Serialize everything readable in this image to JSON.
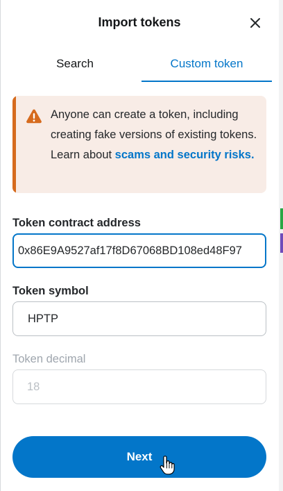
{
  "header": {
    "title": "Import tokens"
  },
  "tabs": [
    {
      "label": "Search",
      "active": false
    },
    {
      "label": "Custom token",
      "active": true
    }
  ],
  "warning": {
    "message": "Anyone can create a token, including creating fake versions of existing tokens. Learn about",
    "link_text": "scams and security risks."
  },
  "form": {
    "contract_label": "Token contract address",
    "contract_value": "0x86E9A9527af17f8D67068BD108ed48F97",
    "symbol_label": "Token symbol",
    "symbol_value": "HPTP",
    "decimal_label": "Token decimal",
    "decimal_value": "18"
  },
  "footer": {
    "next_label": "Next"
  },
  "colors": {
    "accent": "#0376c9",
    "warning_border": "#d66b1e",
    "warning_bg": "#f8ece6",
    "disabled_text": "#9fa6ae"
  },
  "icons": [
    "close-icon",
    "warning-icon",
    "hand-pointer-icon"
  ]
}
